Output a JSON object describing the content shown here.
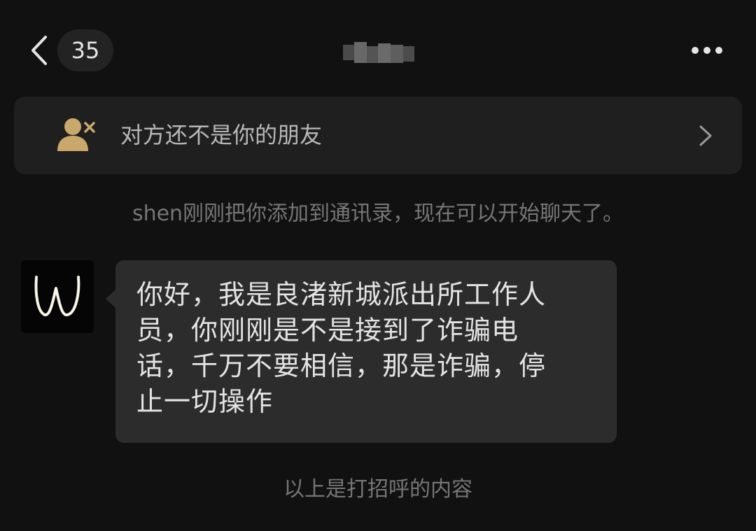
{
  "nav": {
    "unread_count": "35",
    "back_icon": "chevron-left-icon",
    "more_icon": "ellipsis-icon"
  },
  "banner": {
    "text": "对方还不是你的朋友",
    "icon": "user-x-icon",
    "icon_color": "#c9a86b"
  },
  "notes": {
    "added": "shen刚刚把你添加到通讯录，现在可以开始聊天了。",
    "greeting": "以上是打招呼的内容"
  },
  "message": {
    "lines": [
      "你好，我是良渚新城派出所工作人",
      "员，你刚刚是不是接到了诈骗电",
      "话，千万不要相信，那是诈骗，停",
      "止一切操作"
    ],
    "avatar_icon": "letter-w-avatar-icon"
  },
  "colors": {
    "background": "#111111",
    "bubble": "#2c2c2c",
    "banner": "#1f1f1f",
    "accent": "#c9a86b"
  }
}
